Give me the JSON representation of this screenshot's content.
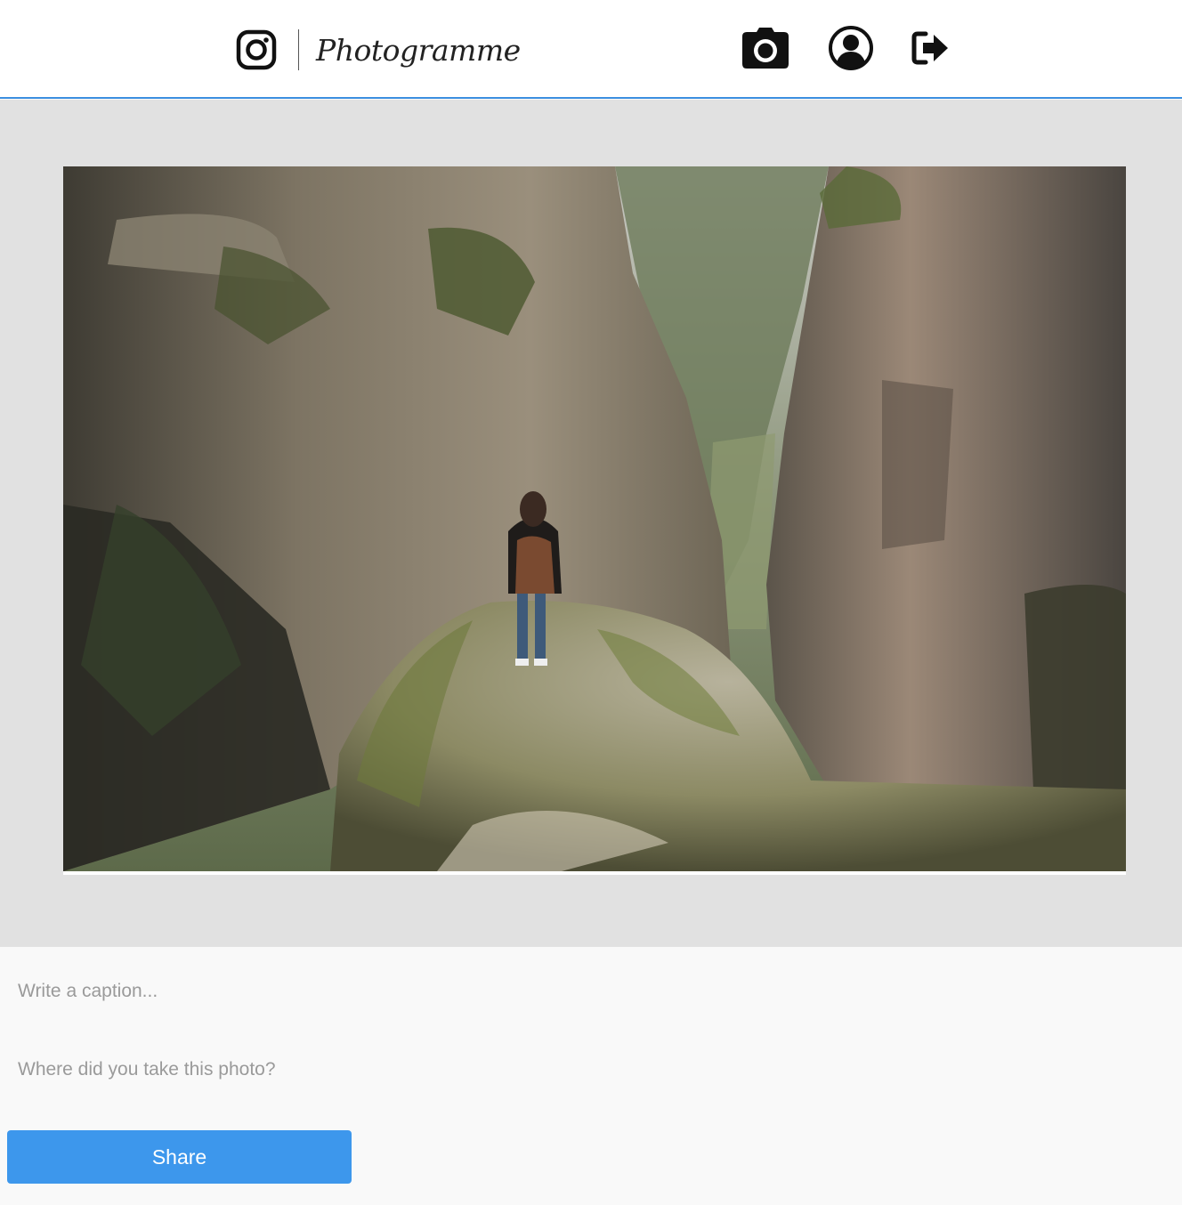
{
  "header": {
    "brand_name": "Photogramme",
    "brand_icon": "instagram-icon",
    "nav": [
      {
        "icon": "camera-icon"
      },
      {
        "icon": "user-circle-icon"
      },
      {
        "icon": "logout-icon"
      }
    ]
  },
  "preview": {
    "image_subject": "photo-preview"
  },
  "form": {
    "caption_placeholder": "Write a caption...",
    "location_placeholder": "Where did you take this photo?",
    "share_label": "Share"
  },
  "colors": {
    "accent": "#3d97ec",
    "header_border": "#3c8fe0",
    "preview_bg": "#e1e1e1",
    "form_bg": "#f9f9f9"
  }
}
